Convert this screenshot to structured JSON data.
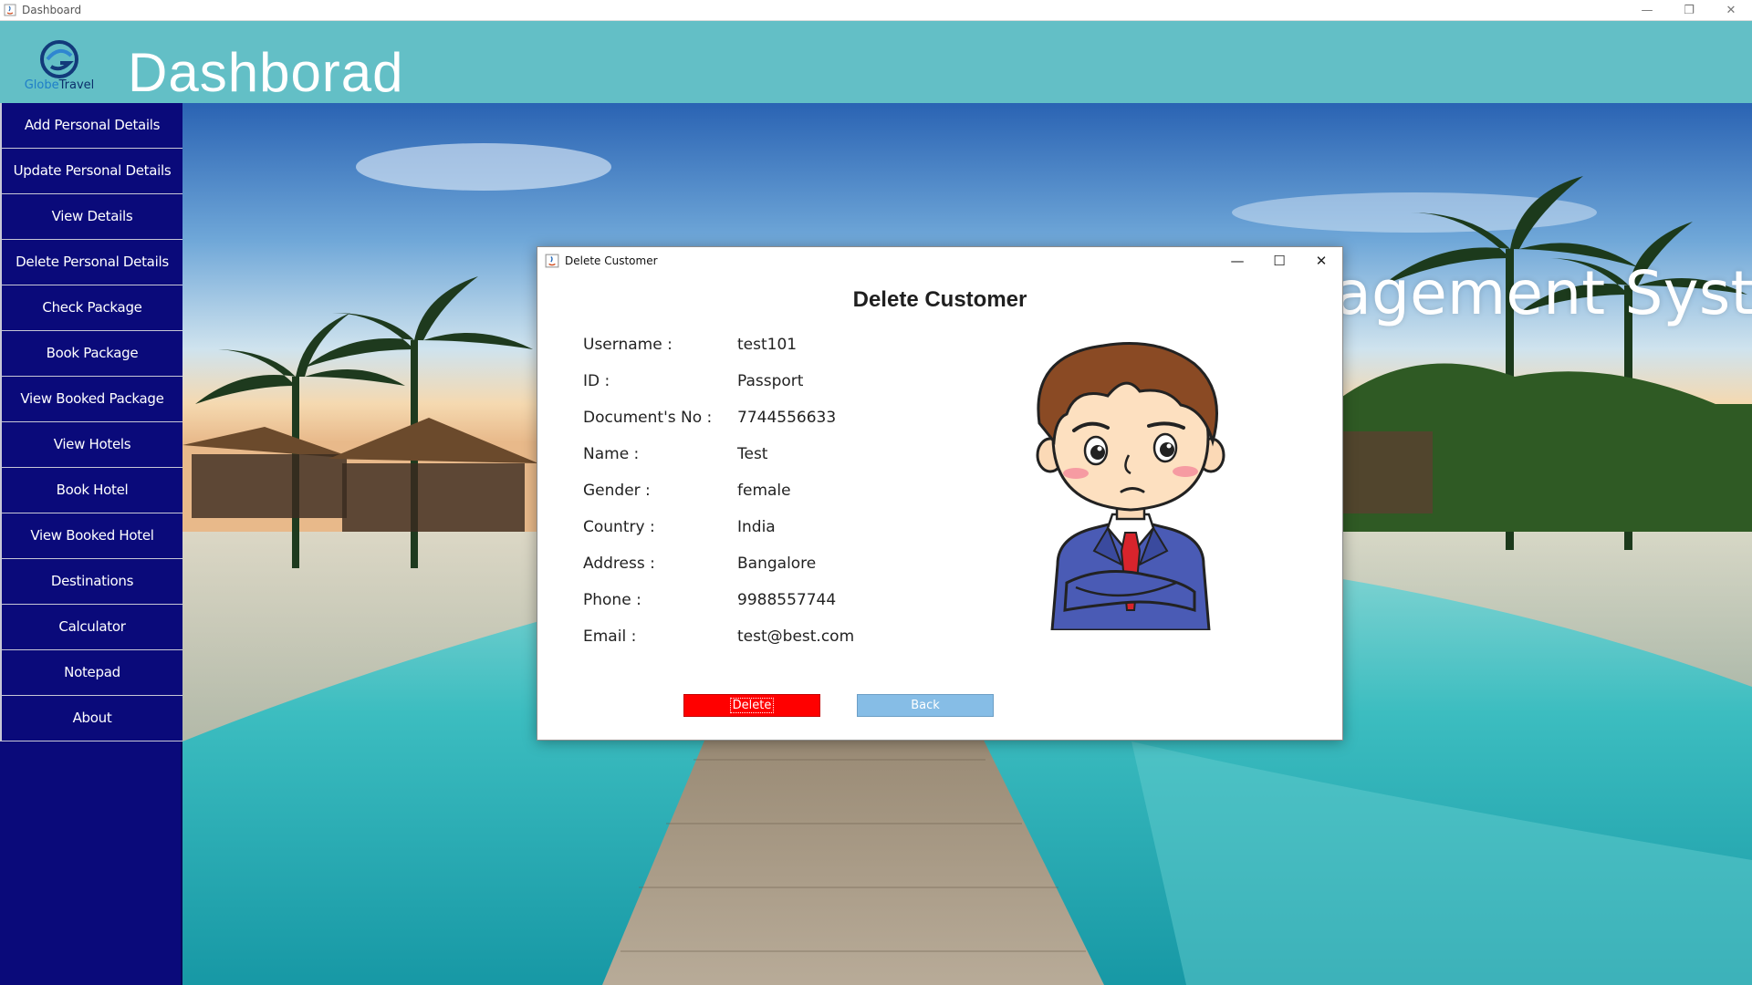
{
  "window": {
    "title": "Dashboard",
    "controls": {
      "minimize": "—",
      "restore": "❐",
      "close": "✕"
    }
  },
  "header": {
    "logo": {
      "part1": "Globe",
      "part2": "Travel"
    },
    "title": "Dashborad"
  },
  "sidebar": {
    "items": [
      {
        "label": "Add Personal Details"
      },
      {
        "label": "Update Personal Details"
      },
      {
        "label": "View Details"
      },
      {
        "label": "Delete Personal Details"
      },
      {
        "label": "Check Package"
      },
      {
        "label": "Book Package"
      },
      {
        "label": "View Booked Package"
      },
      {
        "label": "View Hotels"
      },
      {
        "label": "Book Hotel"
      },
      {
        "label": "View Booked Hotel"
      },
      {
        "label": "Destinations"
      },
      {
        "label": "Calculator"
      },
      {
        "label": "Notepad"
      },
      {
        "label": "About"
      }
    ]
  },
  "main": {
    "title": "Travel and Tourism Management System"
  },
  "dialog": {
    "title": "Delete Customer",
    "controls": {
      "minimize": "—",
      "maximize": "☐",
      "close": "✕"
    },
    "heading": "Delete Customer",
    "fields": [
      {
        "label": "Username  :",
        "value": "test101"
      },
      {
        "label": "ID  :",
        "value": "Passport"
      },
      {
        "label": "Document's No  :",
        "value": "7744556633"
      },
      {
        "label": "Name  :",
        "value": "Test"
      },
      {
        "label": "Gender  :",
        "value": "female"
      },
      {
        "label": "Country  :",
        "value": "India"
      },
      {
        "label": "Address  :",
        "value": "Bangalore"
      },
      {
        "label": "Phone  :",
        "value": "9988557744"
      },
      {
        "label": "Email  :",
        "value": "test@best.com"
      }
    ],
    "delete_label": "Delete",
    "back_label": "Back"
  },
  "colors": {
    "header": "#63bfc6",
    "sidebar": "#0a0a7a",
    "delete_button": "#ff0000",
    "back_button": "#86bde6"
  }
}
